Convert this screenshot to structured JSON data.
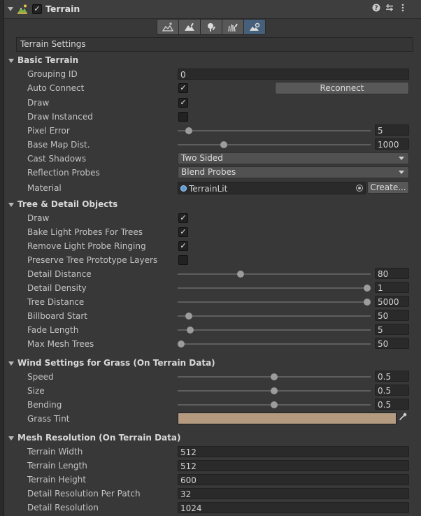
{
  "header": {
    "title": "Terrain",
    "enabled": true,
    "icons": [
      "terrain-icon",
      "help-icon",
      "preset-icon",
      "more-icon"
    ]
  },
  "toolbar": {
    "tools": [
      "raise-lower-terrain-icon",
      "paint-terrain-icon",
      "paint-trees-icon",
      "paint-details-icon",
      "terrain-settings-icon"
    ],
    "active_index": 4
  },
  "settings_title": "Terrain Settings",
  "basic_terrain": {
    "title": "Basic Terrain",
    "grouping_id": {
      "label": "Grouping ID",
      "value": "0"
    },
    "auto_connect": {
      "label": "Auto Connect",
      "checked": true,
      "button": "Reconnect"
    },
    "draw": {
      "label": "Draw",
      "checked": true
    },
    "draw_instanced": {
      "label": "Draw Instanced",
      "checked": false
    },
    "pixel_error": {
      "label": "Pixel Error",
      "value": "5",
      "fraction": 0.04
    },
    "base_map_dist": {
      "label": "Base Map Dist.",
      "value": "1000",
      "fraction": 0.23
    },
    "cast_shadows": {
      "label": "Cast Shadows",
      "value": "Two Sided"
    },
    "reflection_probes": {
      "label": "Reflection Probes",
      "value": "Blend Probes"
    },
    "material": {
      "label": "Material",
      "value": "TerrainLit",
      "button": "Create..."
    }
  },
  "tree_detail": {
    "title": "Tree & Detail Objects",
    "draw": {
      "label": "Draw",
      "checked": true
    },
    "bake_light_probes": {
      "label": "Bake Light Probes For Trees",
      "checked": true
    },
    "remove_ringing": {
      "label": "Remove Light Probe Ringing",
      "checked": true
    },
    "preserve_layers": {
      "label": "Preserve Tree Prototype Layers",
      "checked": false
    },
    "detail_distance": {
      "label": "Detail Distance",
      "value": "80",
      "fraction": 0.32
    },
    "detail_density": {
      "label": "Detail Density",
      "value": "1",
      "fraction": 1.0
    },
    "tree_distance": {
      "label": "Tree Distance",
      "value": "5000",
      "fraction": 1.0
    },
    "billboard_start": {
      "label": "Billboard Start",
      "value": "50",
      "fraction": 0.04
    },
    "fade_length": {
      "label": "Fade Length",
      "value": "5",
      "fraction": 0.05
    },
    "max_mesh_trees": {
      "label": "Max Mesh Trees",
      "value": "50",
      "fraction": 0.0
    }
  },
  "wind": {
    "title": "Wind Settings for Grass (On Terrain Data)",
    "speed": {
      "label": "Speed",
      "value": "0.5",
      "fraction": 0.5
    },
    "size": {
      "label": "Size",
      "value": "0.5",
      "fraction": 0.5
    },
    "bending": {
      "label": "Bending",
      "value": "0.5",
      "fraction": 0.5
    },
    "grass_tint": {
      "label": "Grass Tint",
      "color": "#b49b80"
    }
  },
  "mesh_resolution": {
    "title": "Mesh Resolution (On Terrain Data)",
    "terrain_width": {
      "label": "Terrain Width",
      "value": "512"
    },
    "terrain_length": {
      "label": "Terrain Length",
      "value": "512"
    },
    "terrain_height": {
      "label": "Terrain Height",
      "value": "600"
    },
    "detail_res_per_patch": {
      "label": "Detail Resolution Per Patch",
      "value": "32"
    },
    "detail_resolution": {
      "label": "Detail Resolution",
      "value": "1024"
    }
  },
  "colors": {
    "background": "#383838",
    "field": "#2a2a2a",
    "accent_active": "#46607c",
    "grass_tint": "#b49b80"
  }
}
